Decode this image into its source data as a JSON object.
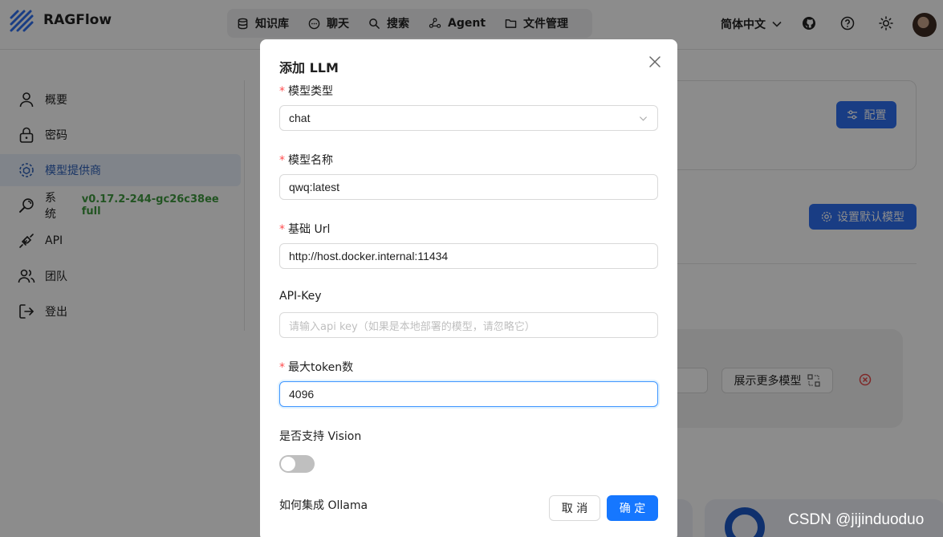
{
  "app": {
    "brand": "RAGFlow"
  },
  "nav": {
    "items": [
      {
        "label": "知识库",
        "icon": "database-icon"
      },
      {
        "label": "聊天",
        "icon": "chat-icon"
      },
      {
        "label": "搜索",
        "icon": "search-icon"
      },
      {
        "label": "Agent",
        "icon": "agent-graph-icon"
      },
      {
        "label": "文件管理",
        "icon": "folder-icon"
      }
    ]
  },
  "header": {
    "language": "简体中文",
    "icons": [
      "github-icon",
      "help-icon",
      "theme-sun-icon",
      "avatar"
    ]
  },
  "sidebar": {
    "items": [
      {
        "label": "概要",
        "icon": "user-icon",
        "active": false
      },
      {
        "label": "密码",
        "icon": "lock-icon",
        "active": false
      },
      {
        "label": "模型提供商",
        "icon": "model-provider-icon",
        "active": true
      },
      {
        "label": "系统",
        "icon": "system-icon",
        "active": false
      },
      {
        "label": "API",
        "icon": "plug-icon",
        "active": false
      },
      {
        "label": "团队",
        "icon": "team-icon",
        "active": false
      },
      {
        "label": "登出",
        "icon": "logout-icon",
        "active": false
      }
    ],
    "version": "v0.17.2-244-gc26c38ee full"
  },
  "background": {
    "config_button": "配置",
    "default_model_button": "设置默认模型",
    "show_more_models_button": "展示更多模型",
    "watermark": "CSDN @jijinduoduo"
  },
  "modal": {
    "title": "添加 LLM",
    "fields": {
      "model_type": {
        "label": "模型类型",
        "required": true,
        "value": "chat"
      },
      "model_name": {
        "label": "模型名称",
        "required": true,
        "value": "qwq:latest"
      },
      "base_url": {
        "label": "基础 Url",
        "required": true,
        "value": "http://host.docker.internal:11434"
      },
      "api_key": {
        "label": "API-Key",
        "required": false,
        "value": "",
        "placeholder": "请输入api key（如果是本地部署的模型，请忽略它）"
      },
      "max_tokens": {
        "label": "最大token数",
        "required": true,
        "value": "4096"
      },
      "vision": {
        "label": "是否支持 Vision",
        "enabled": false
      }
    },
    "help_link": "如何集成 Ollama",
    "cancel": "取 消",
    "ok": "确 定"
  },
  "colors": {
    "primary": "#1677ff",
    "required": "#ff4d4f",
    "active_bg": "#e9f0fb",
    "version_green": "#3f9a3f"
  }
}
